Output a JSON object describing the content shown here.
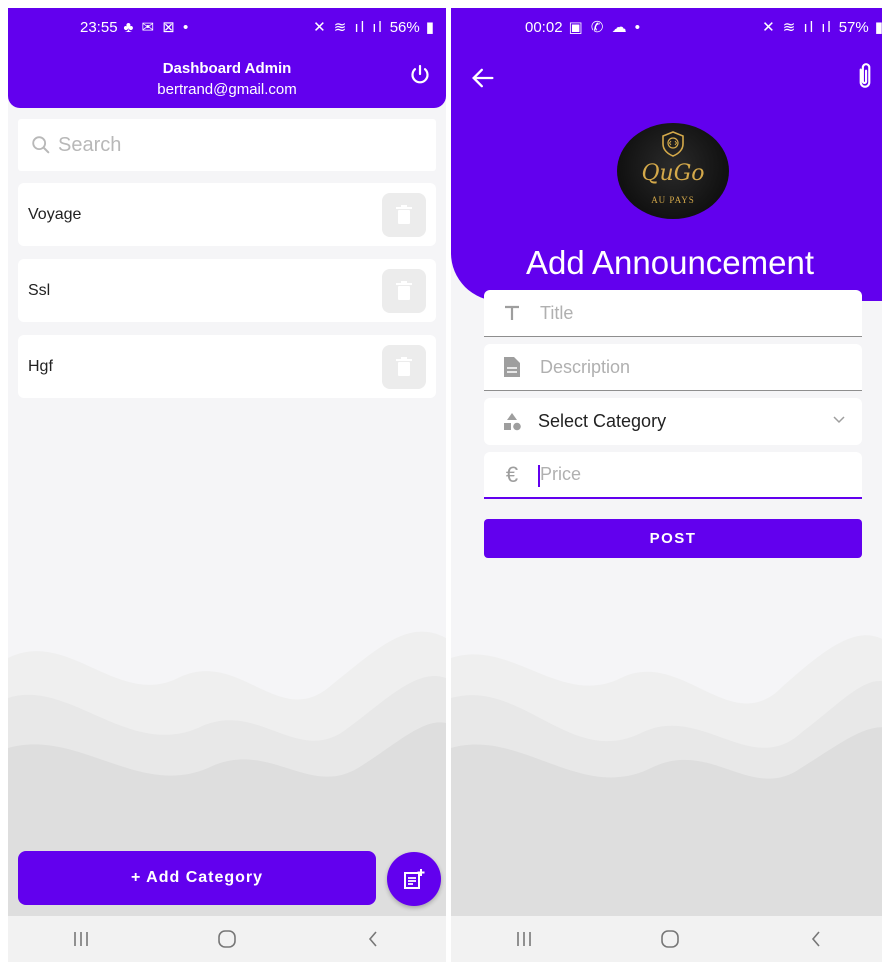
{
  "left": {
    "status": {
      "time": "23:55",
      "battery": "56%"
    },
    "appbar": {
      "title": "Dashboard Admin",
      "email": "bertrand@gmail.com"
    },
    "search": {
      "placeholder": "Search"
    },
    "categories": [
      {
        "label": "Voyage"
      },
      {
        "label": "Ssl"
      },
      {
        "label": "Hgf"
      }
    ],
    "add_button": "+ Add Category"
  },
  "right": {
    "status": {
      "time": "00:02",
      "battery": "57%"
    },
    "logo": {
      "script": "QuGo",
      "sub": "AU PAYS"
    },
    "page_title": "Add Announcement",
    "form": {
      "title_placeholder": "Title",
      "description_placeholder": "Description",
      "category_selected": "Select Category",
      "price_placeholder": "Price",
      "post_label": "POST"
    }
  },
  "colors": {
    "primary": "#6200ee",
    "background": "#f5f5f7",
    "muted_icon": "#9e9e9e"
  }
}
